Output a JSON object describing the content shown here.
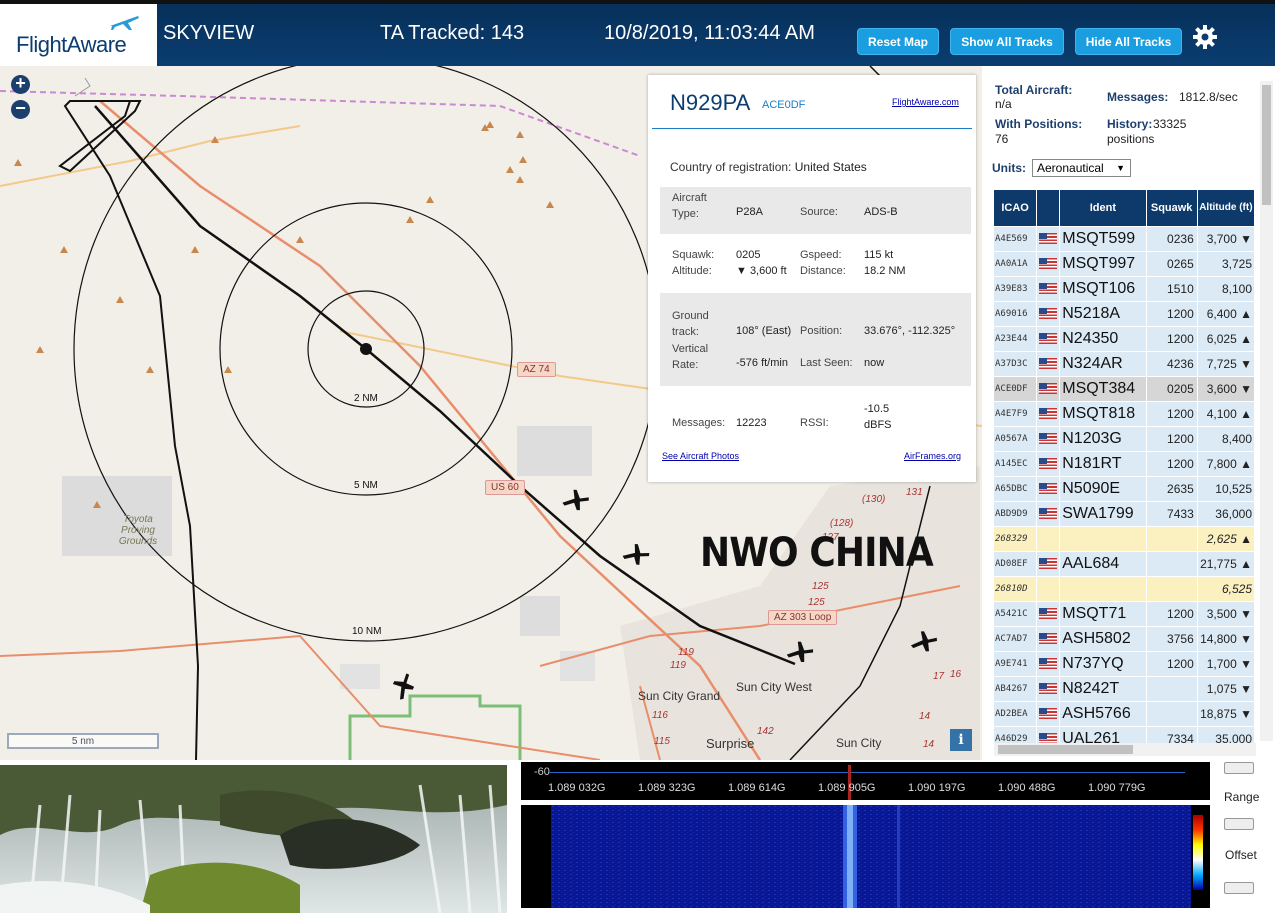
{
  "header": {
    "logo_text": "FlightAware",
    "app_title": "SKYVIEW",
    "tracked": "TA Tracked: 143",
    "clock": "10/8/2019, 11:03:44 AM",
    "btn_reset": "Reset Map",
    "btn_show": "Show All Tracks",
    "btn_hide": "Hide All Tracks",
    "settings_icon": "gear-icon"
  },
  "map": {
    "zoom_in": "+",
    "zoom_out": "−",
    "scale_label": "5 nm",
    "info_label": "i",
    "overlay_text": "NWO CHINA",
    "range_labels": [
      "2 NM",
      "5 NM",
      "10 NM"
    ],
    "roads": [
      "AZ 74",
      "US 60",
      "AZ 303 Loop"
    ],
    "places": [
      "Toyota Proving Grounds",
      "Sun City Grand",
      "Sun City West",
      "Surprise",
      "Sun City"
    ],
    "road_numbers": [
      "(130)",
      "131",
      "(128)",
      "127",
      "125",
      "125",
      "119",
      "119",
      "116",
      "115",
      "142",
      "17",
      "16",
      "14",
      "14"
    ]
  },
  "popup": {
    "registration": "N929PA",
    "hex": "ACE0DF",
    "fa_link": "FlightAware.com",
    "country_label": "Country of registration:",
    "country": "United States",
    "aircraft_type_label": "Aircraft Type:",
    "aircraft_type": "P28A",
    "source_label": "Source:",
    "source": "ADS-B",
    "squawk_label": "Squawk:",
    "squawk": "0205",
    "altitude_label": "Altitude:",
    "altitude": "▼ 3,600 ft",
    "gspeed_label": "Gspeed:",
    "gspeed": "115 kt",
    "distance_label": "Distance:",
    "distance": "18.2 NM",
    "ground_track_label": "Ground track:",
    "ground_track": "108° (East)",
    "position_label": "Position:",
    "position": "33.676°, -112.325°",
    "vrate_label": "Vertical Rate:",
    "vrate": "-576 ft/min",
    "last_seen_label": "Last Seen:",
    "last_seen": "now",
    "messages_label": "Messages:",
    "messages": "12223",
    "rssi_label": "RSSI:",
    "rssi": "-10.5 dBFS",
    "photos_link": "See Aircraft Photos",
    "airframes_link": "AirFrames.org"
  },
  "sidebar": {
    "total_label": "Total Aircraft:",
    "total": "n/a",
    "messages_label": "Messages:",
    "messages": "1812.8/sec",
    "positions_label": "With Positions:",
    "positions": "76",
    "history_label": "History:",
    "history": "33325 positions",
    "units_label": "Units:",
    "units_value": "Aeronautical",
    "columns": [
      "ICAO",
      "",
      "Ident",
      "Squawk",
      "Altitude (ft)"
    ],
    "rows": [
      {
        "icao": "A4E569",
        "flag": true,
        "ident": "MSQT599",
        "squawk": "0236",
        "alt": "3,700 ▼",
        "kind": "normal"
      },
      {
        "icao": "AA0A1A",
        "flag": true,
        "ident": "MSQT997",
        "squawk": "0265",
        "alt": "3,725",
        "kind": "normal"
      },
      {
        "icao": "A39E83",
        "flag": true,
        "ident": "MSQT106",
        "squawk": "1510",
        "alt": "8,100",
        "kind": "normal"
      },
      {
        "icao": "A69016",
        "flag": true,
        "ident": "N5218A",
        "squawk": "1200",
        "alt": "6,400 ▲",
        "kind": "normal"
      },
      {
        "icao": "A23E44",
        "flag": true,
        "ident": "N24350",
        "squawk": "1200",
        "alt": "6,025 ▲",
        "kind": "normal"
      },
      {
        "icao": "A37D3C",
        "flag": true,
        "ident": "N324AR",
        "squawk": "4236",
        "alt": "7,725 ▼",
        "kind": "normal"
      },
      {
        "icao": "ACE0DF",
        "flag": true,
        "ident": "MSQT384",
        "squawk": "0205",
        "alt": "3,600 ▼",
        "kind": "sel"
      },
      {
        "icao": "A4E7F9",
        "flag": true,
        "ident": "MSQT818",
        "squawk": "1200",
        "alt": "4,100 ▲",
        "kind": "normal"
      },
      {
        "icao": "A0567A",
        "flag": true,
        "ident": "N1203G",
        "squawk": "1200",
        "alt": "8,400",
        "kind": "normal"
      },
      {
        "icao": "A145EC",
        "flag": true,
        "ident": "N181RT",
        "squawk": "1200",
        "alt": "7,800 ▲",
        "kind": "normal"
      },
      {
        "icao": "A65DBC",
        "flag": true,
        "ident": "N5090E",
        "squawk": "2635",
        "alt": "10,525",
        "kind": "normal"
      },
      {
        "icao": "ABD9D9",
        "flag": true,
        "ident": "SWA1799",
        "squawk": "7433",
        "alt": "36,000",
        "kind": "normal"
      },
      {
        "icao": "268329",
        "flag": false,
        "ident": "",
        "squawk": "",
        "alt": "2,625 ▲",
        "kind": "nopos"
      },
      {
        "icao": "AD08EF",
        "flag": true,
        "ident": "AAL684",
        "squawk": "",
        "alt": "21,775 ▲",
        "kind": "normal"
      },
      {
        "icao": "26810D",
        "flag": false,
        "ident": "",
        "squawk": "",
        "alt": "6,525",
        "kind": "nopos"
      },
      {
        "icao": "A5421C",
        "flag": true,
        "ident": "MSQT71",
        "squawk": "1200",
        "alt": "3,500 ▼",
        "kind": "normal"
      },
      {
        "icao": "AC7AD7",
        "flag": true,
        "ident": "ASH5802",
        "squawk": "3756",
        "alt": "14,800 ▼",
        "kind": "normal"
      },
      {
        "icao": "A9E741",
        "flag": true,
        "ident": "N737YQ",
        "squawk": "1200",
        "alt": "1,700 ▼",
        "kind": "normal"
      },
      {
        "icao": "AB4267",
        "flag": true,
        "ident": "N8242T",
        "squawk": "",
        "alt": "1,075 ▼",
        "kind": "normal"
      },
      {
        "icao": "AD2BEA",
        "flag": true,
        "ident": "ASH5766",
        "squawk": "",
        "alt": "18,875 ▼",
        "kind": "normal"
      },
      {
        "icao": "A46D29",
        "flag": true,
        "ident": "UAL261",
        "squawk": "7334",
        "alt": "35,000",
        "kind": "normal"
      }
    ]
  },
  "spectrum": {
    "db_label": "-60",
    "frequencies": [
      "1.089 032G",
      "1.089 323G",
      "1.089 614G",
      "1.089 905G",
      "1.090 197G",
      "1.090 488G",
      "1.090 779G"
    ],
    "range_label": "Range",
    "offset_label": "Offset"
  }
}
